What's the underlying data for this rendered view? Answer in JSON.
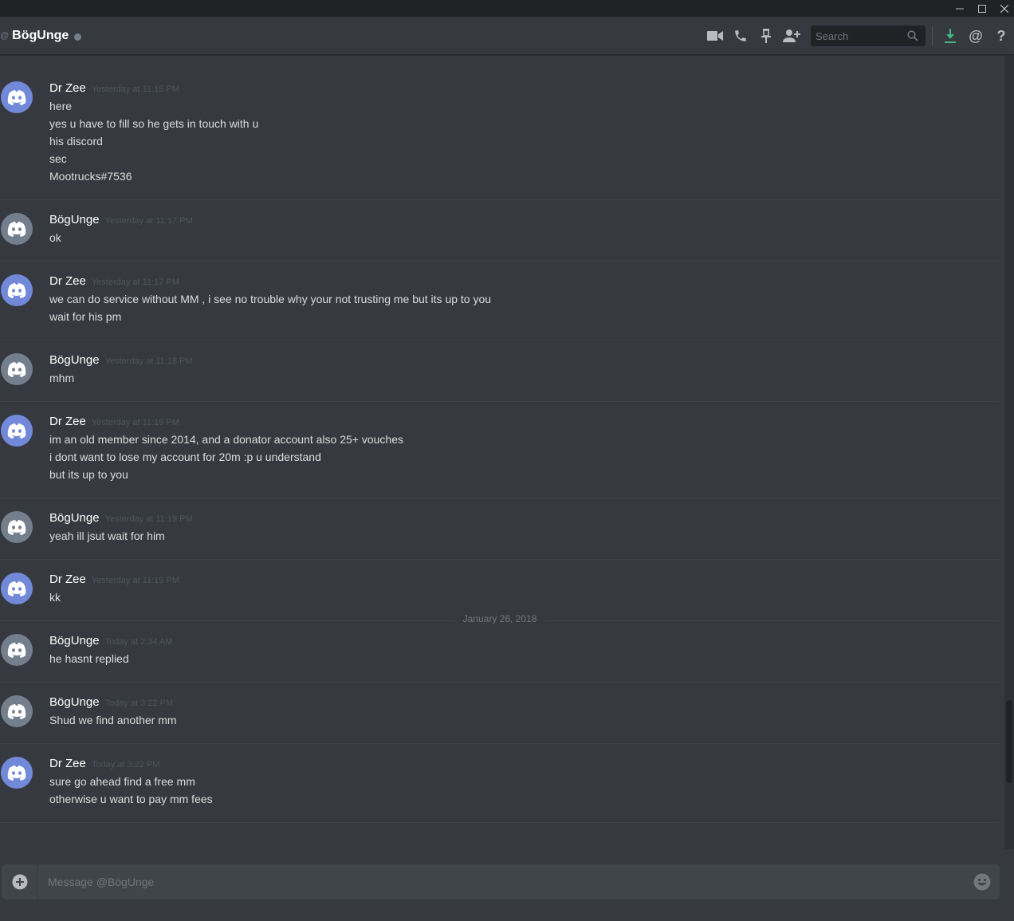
{
  "window": {
    "controls": [
      "minimize",
      "maximize",
      "close"
    ]
  },
  "header": {
    "at_symbol": "@",
    "channel_name": "BögUnge",
    "search_placeholder": "Search",
    "icons": [
      "video-call-icon",
      "voice-call-icon",
      "pin-icon",
      "add-friend-icon",
      "search-icon",
      "download-icon",
      "mention-icon",
      "help-icon"
    ]
  },
  "colors": {
    "background": "#36393f",
    "titlebar": "#202225",
    "avatar_blurple": "#7289da",
    "avatar_grey": "#747f8d",
    "download_green": "#43b581"
  },
  "date_divider": "January 26, 2018",
  "messages": [
    {
      "username": "Dr Zee",
      "timestamp": "Yesterday at 11:15 PM",
      "avatar_color": "#7289da",
      "lines": [
        "here",
        "yes u have to fill so he gets in touch with u",
        "his discord",
        "sec",
        "Mootrucks#7536"
      ]
    },
    {
      "username": "BögUnge",
      "timestamp": "Yesterday at 11:17 PM",
      "avatar_color": "#747f8d",
      "lines": [
        "ok"
      ]
    },
    {
      "username": "Dr Zee",
      "timestamp": "Yesterday at 11:17 PM",
      "avatar_color": "#7289da",
      "lines": [
        "we can do service without MM , i see no trouble why your not trusting me but its up to you",
        "wait for his pm"
      ]
    },
    {
      "username": "BögUnge",
      "timestamp": "Yesterday at 11:18 PM",
      "avatar_color": "#747f8d",
      "lines": [
        "mhm"
      ]
    },
    {
      "username": "Dr Zee",
      "timestamp": "Yesterday at 11:19 PM",
      "avatar_color": "#7289da",
      "lines": [
        "im an old member since 2014, and a donator account also 25+ vouches",
        "i dont want to lose my account for 20m :p u understand",
        "but its up to you"
      ]
    },
    {
      "username": "BögUnge",
      "timestamp": "Yesterday at 11:19 PM",
      "avatar_color": "#747f8d",
      "lines": [
        "yeah ill jsut wait for him"
      ]
    },
    {
      "username": "Dr Zee",
      "timestamp": "Yesterday at 11:19 PM",
      "avatar_color": "#7289da",
      "lines": [
        "kk"
      ]
    },
    {
      "username": "BögUnge",
      "timestamp": "Today at 2:34 AM",
      "avatar_color": "#747f8d",
      "lines": [
        "he hasnt replied"
      ]
    },
    {
      "username": "BögUnge",
      "timestamp": "Today at 3:22 PM",
      "avatar_color": "#747f8d",
      "lines": [
        "Shud we find another mm"
      ]
    },
    {
      "username": "Dr Zee",
      "timestamp": "Today at 3:22 PM",
      "avatar_color": "#7289da",
      "lines": [
        "sure go ahead find a free mm",
        "otherwise u want to pay mm fees"
      ]
    }
  ],
  "composer": {
    "placeholder": "Message @BögUnge"
  }
}
